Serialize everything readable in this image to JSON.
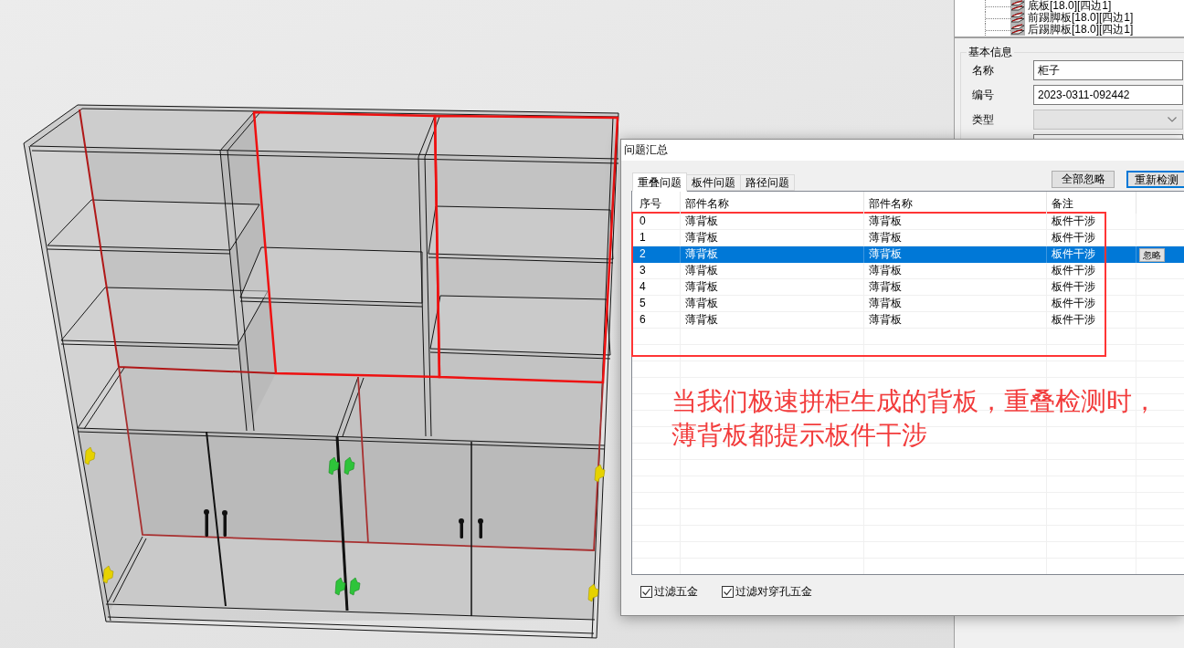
{
  "tree": {
    "items": [
      {
        "label": "底板[18.0][四边1]"
      },
      {
        "label": "前踢脚板[18.0][四边1]"
      },
      {
        "label": "后踢脚板[18.0][四边1]"
      }
    ]
  },
  "basic_info": {
    "title": "基本信息",
    "fields": [
      {
        "kind": "text",
        "label": "名称",
        "value": "柜子"
      },
      {
        "kind": "text",
        "label": "编号",
        "value": "2023-0311-092442"
      },
      {
        "kind": "dropdown",
        "label": "类型",
        "disabled": true
      },
      {
        "kind": "text"
      }
    ]
  },
  "dialog": {
    "title": "问题汇总",
    "tabs": [
      {
        "label": "重叠问题",
        "selected": true
      },
      {
        "label": "板件问题",
        "selected": false
      },
      {
        "label": "路径问题",
        "selected": false
      }
    ],
    "buttons": [
      {
        "label": "全部忽略",
        "default": false
      },
      {
        "label": "重新检测",
        "default": true
      }
    ],
    "table": {
      "columns": [
        "序号",
        "部件名称",
        "部件名称",
        "备注"
      ],
      "rows": [
        {
          "index": "0",
          "part_a": "薄背板",
          "part_b": "薄背板",
          "note": "板件干涉",
          "selected": false
        },
        {
          "index": "1",
          "part_a": "薄背板",
          "part_b": "薄背板",
          "note": "板件干涉",
          "selected": false
        },
        {
          "index": "2",
          "part_a": "薄背板",
          "part_b": "薄背板",
          "note": "板件干涉",
          "selected": true,
          "action": "忽略"
        },
        {
          "index": "3",
          "part_a": "薄背板",
          "part_b": "薄背板",
          "note": "板件干涉",
          "selected": false
        },
        {
          "index": "4",
          "part_a": "薄背板",
          "part_b": "薄背板",
          "note": "板件干涉",
          "selected": false
        },
        {
          "index": "5",
          "part_a": "薄背板",
          "part_b": "薄背板",
          "note": "板件干涉",
          "selected": false
        },
        {
          "index": "6",
          "part_a": "薄背板",
          "part_b": "薄背板",
          "note": "板件干涉",
          "selected": false
        }
      ]
    },
    "filters": [
      {
        "label": "过滤五金",
        "checked": true
      },
      {
        "label": "过滤对穿孔五金",
        "checked": true
      }
    ]
  },
  "annotation": {
    "lines": [
      "当我们极速拼柜生成的背板，重叠检测时，",
      "薄背板都提示板件干涉"
    ]
  }
}
